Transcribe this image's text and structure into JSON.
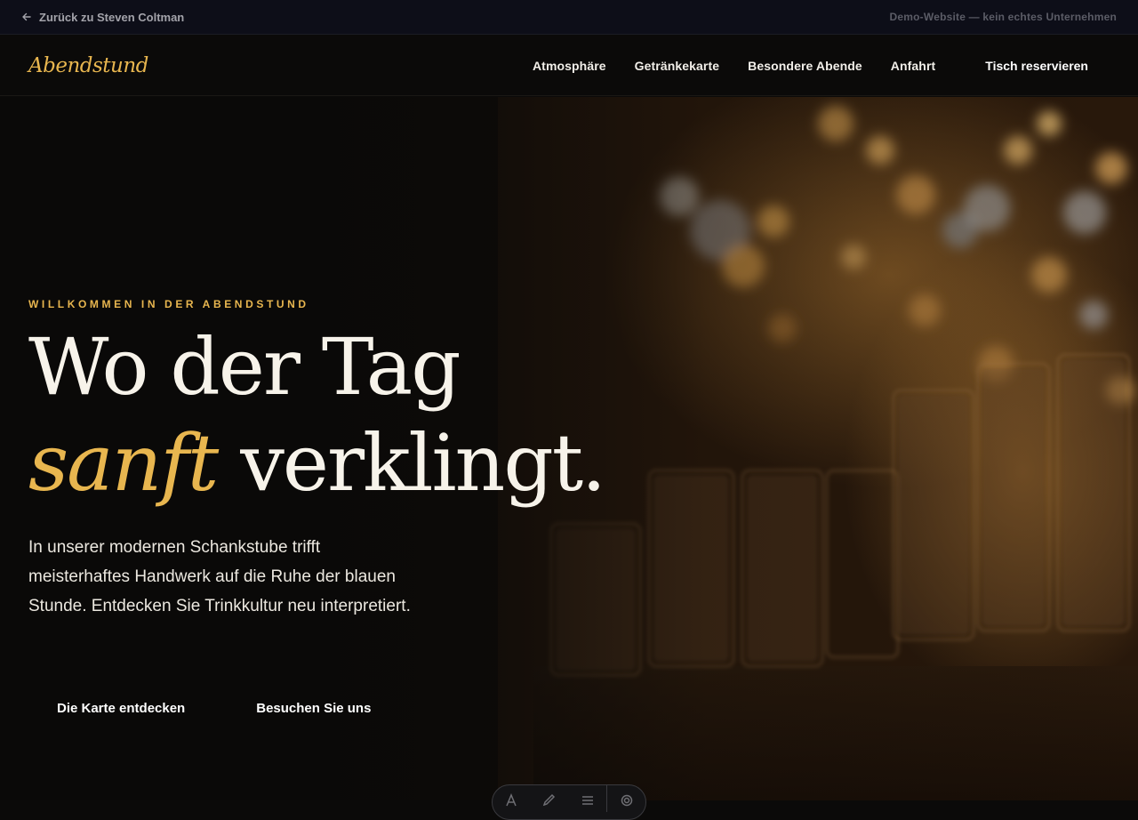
{
  "demo_bar": {
    "back_label": "Zurück zu Steven Coltman",
    "back_icon": "arrow-left-icon",
    "note": "Demo-Website — kein echtes Unternehmen"
  },
  "header": {
    "logo": "Abendstund",
    "nav": [
      {
        "label": "Atmosphäre"
      },
      {
        "label": "Getränkekarte"
      },
      {
        "label": "Besondere Abende"
      },
      {
        "label": "Anfahrt"
      }
    ],
    "cta": "Tisch reservieren"
  },
  "hero": {
    "eyebrow": "WILLKOMMEN IN DER ABENDSTUND",
    "headline_line1": "Wo der Tag",
    "headline_accent": "sanft",
    "headline_rest": " verklingt.",
    "intro": "In unserer modernen Schankstube trifft meisterhaftes Handwerk auf die Ruhe der blauen Stunde. Entdecken Sie Trinkkultur neu interpretiert.",
    "primary_button": "Die Karte entdecken",
    "secondary_button": "Besuchen Sie uns",
    "background_image": "bar-glasses-bokeh-photo"
  },
  "toolbar": {
    "icons": [
      "text-icon",
      "pen-icon",
      "menu-icon",
      "settings-icon"
    ]
  },
  "colors": {
    "accent": "#e8b64f",
    "background": "#0b0a09",
    "demo_bar": "#0d0e18",
    "text": "#f4efe6"
  }
}
